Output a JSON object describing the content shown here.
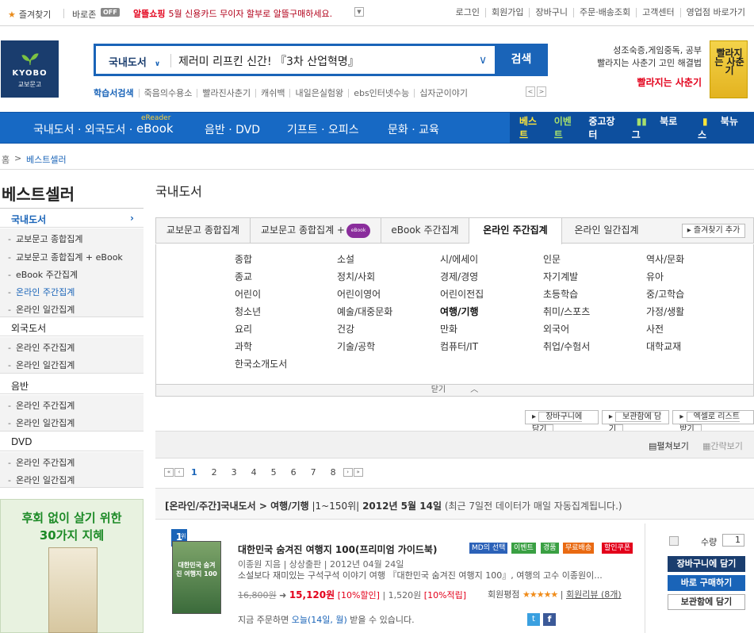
{
  "topbar": {
    "favorites": "즐겨찾기",
    "baro": "바로존",
    "off_badge": "OFF",
    "promo_label": "알뜰쇼핑",
    "promo_text": "5월 신용카드 무이자 할부로 알뜰구매하세요.",
    "links": [
      "로그인",
      "회원가입",
      "장바구니",
      "주문·배송조회",
      "고객센터",
      "영업점 바로가기"
    ]
  },
  "logo": {
    "name": "KYOBO",
    "sub": "교보문고"
  },
  "search": {
    "category": "국내도서",
    "query": "제러미 리프킨 신간! 『3차 산업혁명』",
    "button": "검색",
    "hot_title": "학습서검색",
    "hot_words": [
      "죽음의수용소",
      "빨라진사춘기",
      "캐쉬백",
      "내일은실험왕",
      "ebs인터넷수능",
      "십자군이야기"
    ]
  },
  "ad": {
    "line1": "성조숙증,게임중독, 공부",
    "line2": "빨라지는 사춘기 고민 해결법",
    "link": "빨라지는 사춘기",
    "book_title": "빨라지는 사춘기"
  },
  "gnb": {
    "menu": [
      "국내도서 · 외국도서 ·",
      "eBook",
      "음반 · DVD",
      "기프트 · 오피스",
      "문화 · 교육"
    ],
    "ereader": "eReader",
    "right": [
      "베스트",
      "이벤트",
      "중고장터",
      "북로그",
      "북뉴스"
    ]
  },
  "breadcrumb": {
    "home": "홈",
    "sep": ">",
    "current": "베스트셀러"
  },
  "sidebar": {
    "title": "베스트셀러",
    "groups": [
      {
        "label": "국내도서",
        "items": [
          "교보문고 종합집계",
          "교보문고 종합집계 + eBook",
          "eBook 주간집계",
          "온라인 주간집계",
          "온라인 일간집계"
        ]
      },
      {
        "label": "외국도서",
        "items": [
          "온라인 주간집계",
          "온라인 일간집계"
        ]
      },
      {
        "label": "음반",
        "items": [
          "온라인 주간집계",
          "온라인 일간집계"
        ]
      },
      {
        "label": "DVD",
        "items": [
          "온라인 주간집계",
          "온라인 일간집계"
        ]
      }
    ],
    "ad_line1": "후회 없이 살기 위한",
    "ad_line2": "30가지 지혜"
  },
  "main": {
    "title": "국내도서",
    "tabs": [
      "교보문고 종합집계",
      "교보문고 종합집계 +",
      "eBook 주간집계",
      "온라인 주간집계",
      "온라인 일간집계"
    ],
    "ebook_badge": "eBook",
    "add_favorite": "즐겨찾기 추가",
    "categories": [
      [
        "종합",
        "소설",
        "시/에세이",
        "인문",
        "역사/문화"
      ],
      [
        "종교",
        "정치/사회",
        "경제/경영",
        "자기계발",
        "유아"
      ],
      [
        "어린이",
        "어린이영어",
        "어린이전집",
        "초등학습",
        "중/고학습"
      ],
      [
        "청소년",
        "예술/대중문화",
        "여행/기행",
        "취미/스포츠",
        "가정/생활"
      ],
      [
        "요리",
        "건강",
        "만화",
        "외국어",
        "사전"
      ],
      [
        "과학",
        "기술/공학",
        "컴퓨터/IT",
        "취업/수험서",
        "대학교재"
      ],
      [
        "한국소개도서",
        "",
        "",
        "",
        ""
      ]
    ],
    "close": "닫기",
    "actions": [
      "장바구니에 담기",
      "보관함에 담기",
      "엑셀로 리스트 받기"
    ],
    "view_expanded": "펼쳐보기",
    "view_simple": "간략보기",
    "pages": [
      "1",
      "2",
      "3",
      "4",
      "5",
      "6",
      "7",
      "8"
    ],
    "rank_title": "[온라인/주간]국내도서 > 여행/기행",
    "rank_range": "|1~150위|",
    "rank_date": "2012년 5월 14일",
    "rank_note": "(최근 7일전 데이터가 매일 자동집계됩니다.)"
  },
  "item": {
    "rank": "1",
    "rank_suffix": "위",
    "title": "대한민국 숨겨진 여행지 100(프리미엄 가이드북)",
    "badges": [
      "MD의 선택",
      "이벤트",
      "경품",
      "무료배송",
      "할인쿠폰"
    ],
    "author": "이종원 지음 | 상상출판 | 2012년 04월 24일",
    "desc": "소설보다 재미있는 구석구석 이야기 여행 『대한민국 숨겨진 여행지 100』, 여행의 고수 이종원이...",
    "orig_price": "16,800원",
    "sale_price": "15,120원",
    "discount": "[10%할인]",
    "points": "1,520원",
    "points_rate": "[10%적립]",
    "rating_label": "회원평점",
    "stars": "★★★★★",
    "review": "회원리뷰 (8개)",
    "delivery_pre": "지금 주문하면",
    "delivery_day": "오늘(14일, 월)",
    "delivery_post": "받을 수 있습니다.",
    "qty_label": "수량",
    "qty": "1",
    "btn_cart": "장바구니에 담기",
    "btn_buy": "바로 구매하기",
    "btn_keep": "보관함에 담기",
    "cover_text": "대한민국 숨겨진 여행지 100"
  }
}
